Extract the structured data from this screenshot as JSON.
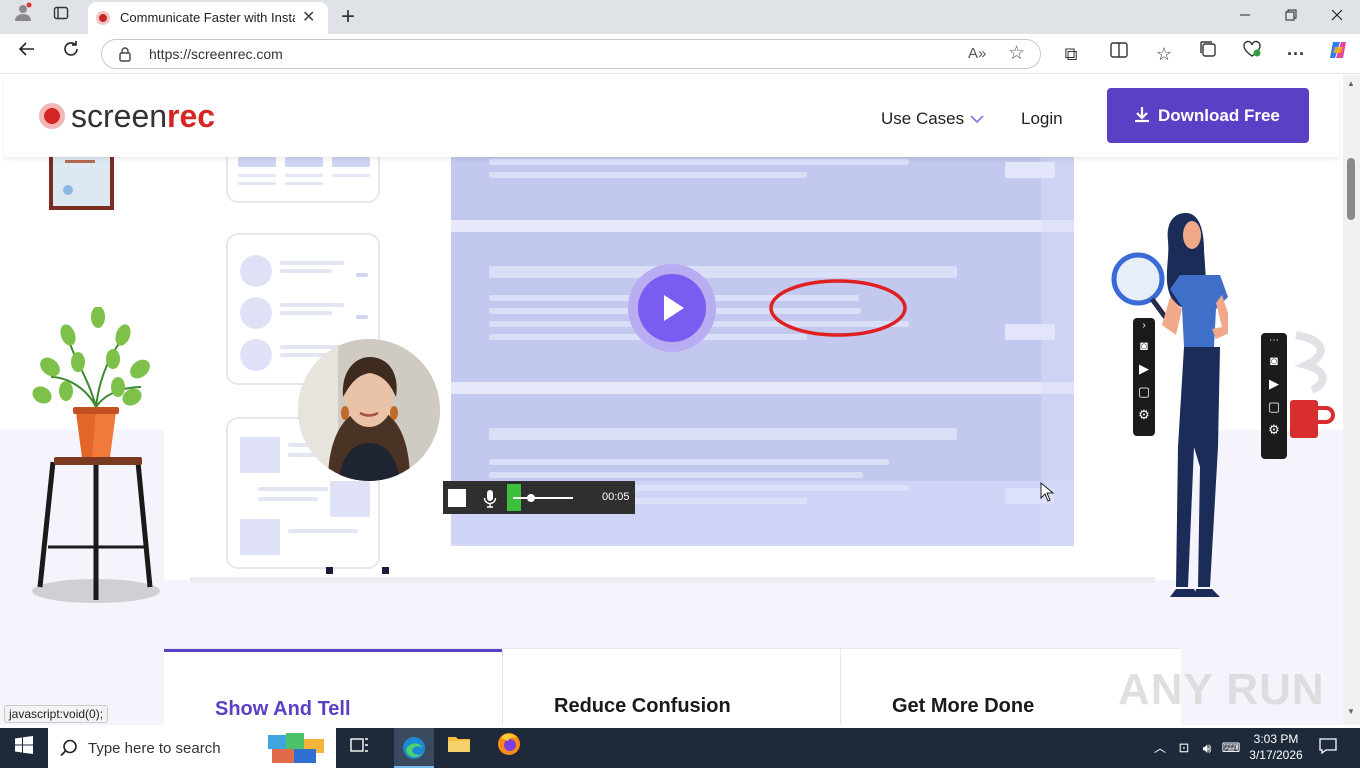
{
  "browser": {
    "tab_title": "Communicate Faster with Instant",
    "url": "https://screenrec.com",
    "new_tab_label": "+"
  },
  "header": {
    "logo_text_1": "screen",
    "logo_text_2": "rec",
    "nav_use_cases": "Use Cases",
    "nav_login": "Login",
    "download_label": "Download Free"
  },
  "player": {
    "time": "00:05"
  },
  "features": [
    {
      "label": "Show And Tell",
      "active": true
    },
    {
      "label": "Reduce Confusion",
      "active": false
    },
    {
      "label": "Get More Done",
      "active": false
    }
  ],
  "status_bar": "javascript:void(0);",
  "watermark": "ANY RUN",
  "taskbar": {
    "search_placeholder": "Type here to search",
    "time": "3:03 PM",
    "date": "3/17/2026"
  },
  "colors": {
    "brand_purple": "#5b3fc4",
    "accent_red": "#d62525",
    "play_purple": "#7b5cf0"
  }
}
